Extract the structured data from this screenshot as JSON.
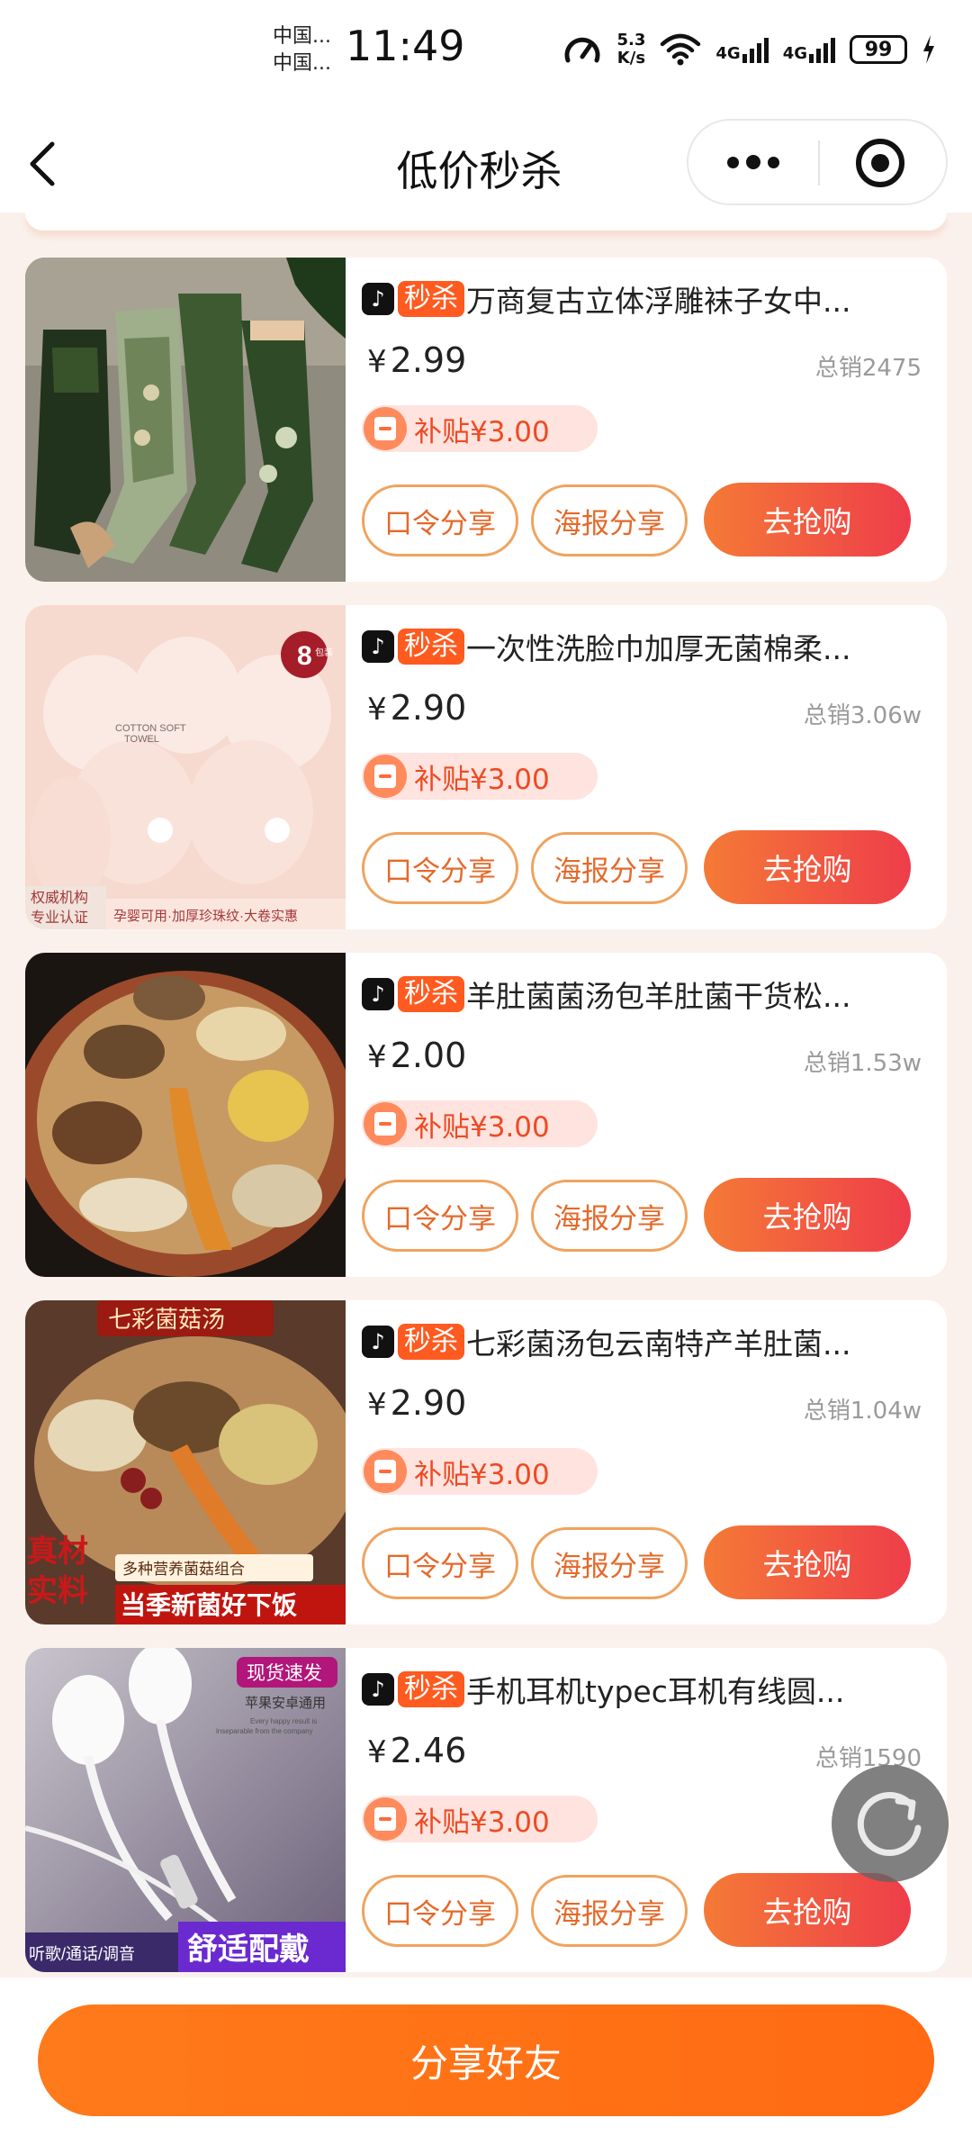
{
  "status_bar": {
    "carrier_1": "中国...",
    "carrier_2": "中国...",
    "time": "11:49",
    "speed_value": "5.3",
    "speed_unit": "K/s",
    "sim1": "4G",
    "sim2": "4G",
    "battery": "99"
  },
  "nav": {
    "title": "低价秒杀"
  },
  "products": [
    {
      "badge": "秒杀",
      "title": "万商复古立体浮雕袜子女中...",
      "currency": "¥",
      "price": "2.99",
      "sales": "总销2475",
      "subsidy": "补贴¥3.00",
      "share_code": "口令分享",
      "share_poster": "海报分享",
      "buy": "去抢购"
    },
    {
      "badge": "秒杀",
      "title": "一次性洗脸巾加厚无菌棉柔...",
      "currency": "¥",
      "price": "2.90",
      "sales": "总销3.06w",
      "subsidy": "补贴¥3.00",
      "share_code": "口令分享",
      "share_poster": "海报分享",
      "buy": "去抢购",
      "image_text": {
        "count": "8",
        "unit": "包装",
        "brand_1": "COTTON SOFT",
        "brand_2": "TOWEL",
        "left_tag_1": "权威机构",
        "left_tag_2": "专业认证",
        "bottom": "孕婴可用·加厚珍珠纹·大卷实惠"
      }
    },
    {
      "badge": "秒杀",
      "title": "羊肚菌菌汤包羊肚菌干货松...",
      "currency": "¥",
      "price": "2.00",
      "sales": "总销1.53w",
      "subsidy": "补贴¥3.00",
      "share_code": "口令分享",
      "share_poster": "海报分享",
      "buy": "去抢购"
    },
    {
      "badge": "秒杀",
      "title": "七彩菌汤包云南特产羊肚菌...",
      "currency": "¥",
      "price": "2.90",
      "sales": "总销1.04w",
      "subsidy": "补贴¥3.00",
      "share_code": "口令分享",
      "share_poster": "海报分享",
      "buy": "去抢购",
      "image_text": {
        "top": "七彩菌菇汤",
        "left_1": "真材",
        "left_2": "实料",
        "mid": "多种营养菌菇组合",
        "bottom": "当季新菌好下饭"
      }
    },
    {
      "badge": "秒杀",
      "title": "手机耳机typec耳机有线圆...",
      "currency": "¥",
      "price": "2.46",
      "sales": "总销1590",
      "subsidy": "补贴¥3.00",
      "share_code": "口令分享",
      "share_poster": "海报分享",
      "buy": "去抢购",
      "image_text": {
        "tag": "现货速发",
        "sub": "苹果安卓通用",
        "tiny_1": "Every happy result is",
        "tiny_2": "inseparable from the company",
        "bottom_left": "听歌/通话/调音",
        "bottom_right": "舒适配戴"
      }
    }
  ],
  "bottom": {
    "share_label": "分享好友"
  },
  "colors": {
    "accent": "#ff7a1a",
    "badge": "#ff5a1f",
    "button_gradient_start": "#f57a36",
    "button_gradient_end": "#ee3d4a"
  },
  "icons": [
    "back-arrow-icon",
    "more-dots-icon",
    "target-icon",
    "tiktok-icon",
    "coupon-icon",
    "refresh-icon"
  ]
}
